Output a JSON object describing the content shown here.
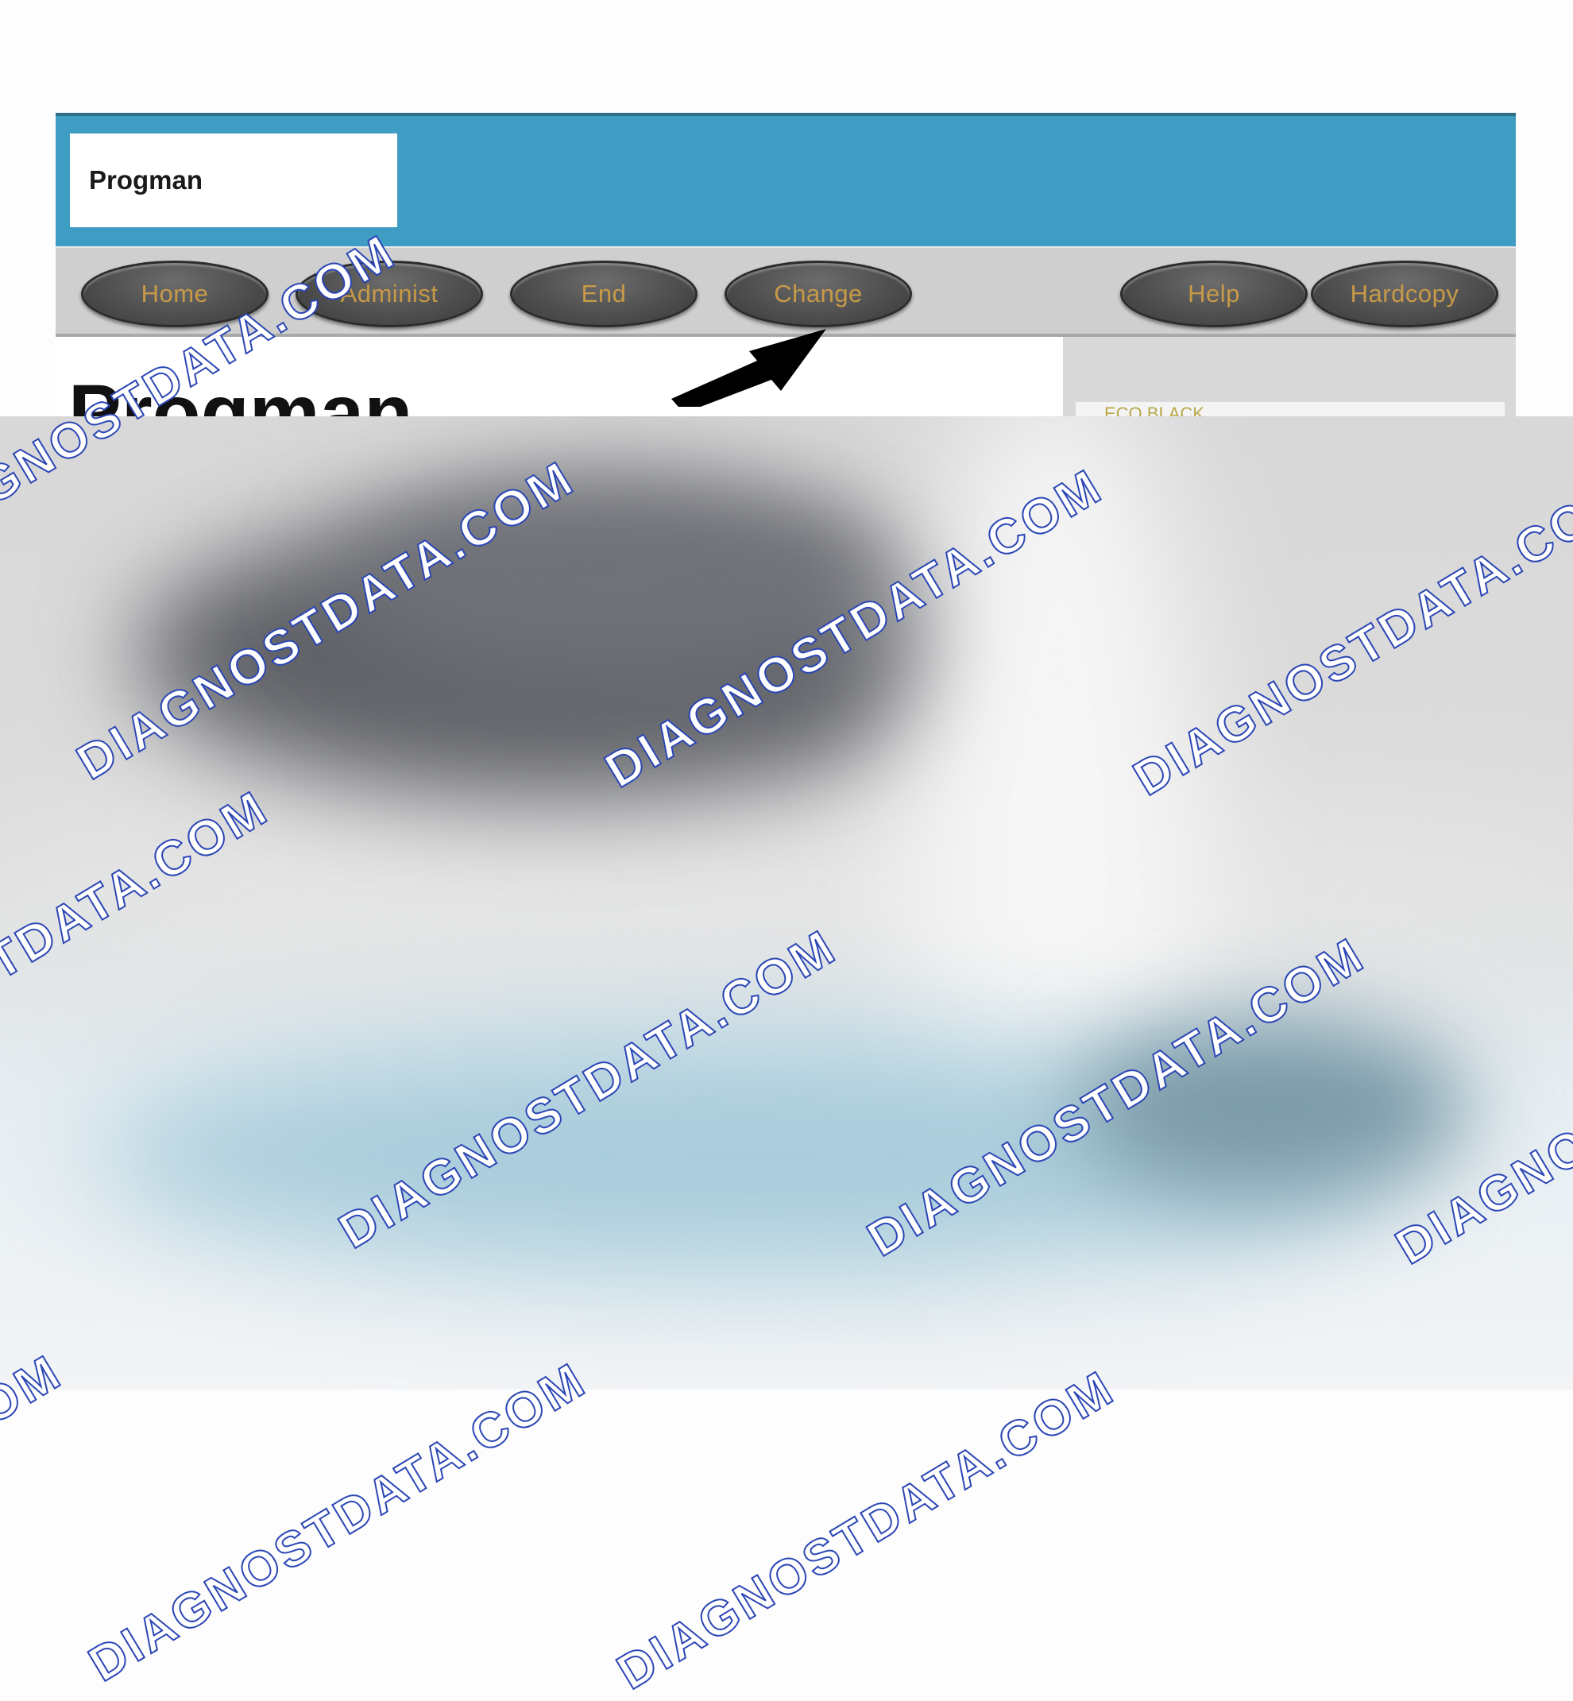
{
  "window": {
    "app_name": "Progman",
    "page_title": "Progman"
  },
  "toolbar": {
    "buttons": [
      {
        "label": "Home"
      },
      {
        "label": "Administ"
      },
      {
        "label": "End"
      },
      {
        "label": "Change"
      },
      {
        "label": "Help"
      },
      {
        "label": "Hardcopy"
      }
    ]
  },
  "side_panel": {
    "text": "ECO BLACK"
  },
  "annotation": {
    "arrow_target": "Change"
  },
  "watermark": {
    "text": "DIAGNOSTDATA.COM"
  },
  "colors": {
    "header_blue": "#3f9cc2",
    "toolbar_gray": "#cfcfcf",
    "button_label": "#c79a48",
    "watermark_stroke": "#2b46b5"
  }
}
